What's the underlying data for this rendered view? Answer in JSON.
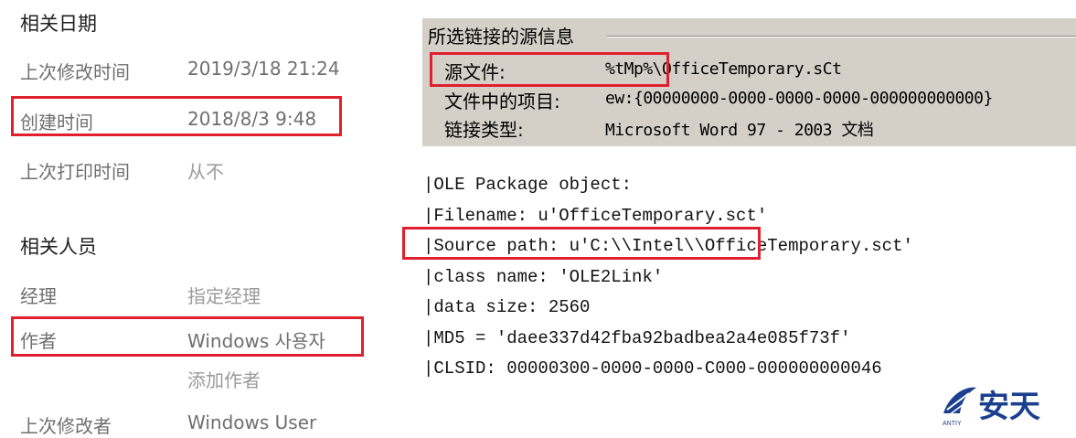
{
  "related_dates": {
    "title": "相关日期",
    "rows": [
      {
        "label": "上次修改时间",
        "value": "2019/3/18 21:24"
      },
      {
        "label": "创建时间",
        "value": "2018/8/3 9:48"
      },
      {
        "label": "上次打印时间",
        "value": "从不"
      }
    ]
  },
  "related_people": {
    "title": "相关人员",
    "rows": [
      {
        "label": "经理",
        "value": "指定经理"
      },
      {
        "label": "作者",
        "value": "Windows 사용자"
      },
      {
        "label": "",
        "value": "添加作者"
      },
      {
        "label": "上次修改者",
        "value": "Windows User"
      }
    ]
  },
  "source_info": {
    "title": "所选链接的源信息",
    "rows": [
      {
        "key": "源文件:",
        "value": "%tMp%\\OfficeTemporary.sCt"
      },
      {
        "key": "文件中的项目:",
        "value": "ew:{00000000-0000-0000-0000-000000000000}"
      },
      {
        "key": "链接类型:",
        "value": "Microsoft Word 97 - 2003 文档"
      }
    ]
  },
  "ole_output": [
    "|OLE Package object:",
    "|Filename: u'OfficeTemporary.sct'",
    "|Source path: u'C:\\\\Intel\\\\OfficeTemporary.sct'",
    "|class name: 'OLE2Link'",
    "|data size: 2560",
    "|MD5 = 'daee337d42fba92badbea2a4e085f73f'",
    "|CLSID: 00000300-0000-0000-C000-000000000046"
  ],
  "watermark": {
    "text": "安天",
    "sub": "ANTIY"
  },
  "colors": {
    "highlight": "#e0202e",
    "panel_bg": "#d4d0c8",
    "watermark": "#1b3f8f"
  }
}
